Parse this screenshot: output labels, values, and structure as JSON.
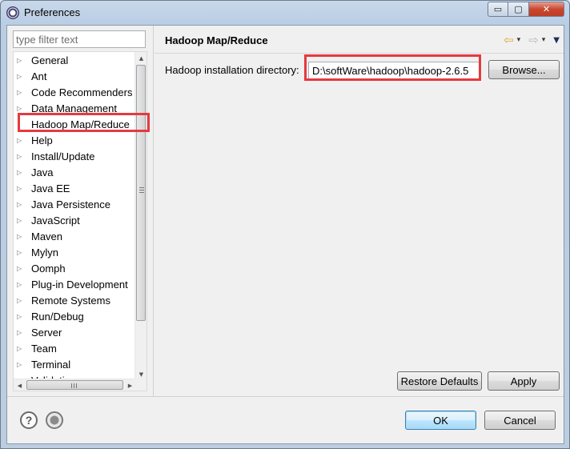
{
  "window": {
    "title": "Preferences",
    "minimize_glyph": "▭",
    "maximize_glyph": "▢",
    "close_glyph": "✕"
  },
  "left_pane": {
    "filter_placeholder": "type filter text",
    "tree_items": [
      {
        "label": "General",
        "has_arrow": true
      },
      {
        "label": "Ant",
        "has_arrow": true
      },
      {
        "label": "Code Recommenders",
        "has_arrow": true
      },
      {
        "label": "Data Management",
        "has_arrow": true
      },
      {
        "label": "Hadoop Map/Reduce",
        "has_arrow": false,
        "selected": true
      },
      {
        "label": "Help",
        "has_arrow": true
      },
      {
        "label": "Install/Update",
        "has_arrow": true
      },
      {
        "label": "Java",
        "has_arrow": true
      },
      {
        "label": "Java EE",
        "has_arrow": true
      },
      {
        "label": "Java Persistence",
        "has_arrow": true
      },
      {
        "label": "JavaScript",
        "has_arrow": true
      },
      {
        "label": "Maven",
        "has_arrow": true
      },
      {
        "label": "Mylyn",
        "has_arrow": true
      },
      {
        "label": "Oomph",
        "has_arrow": true
      },
      {
        "label": "Plug-in Development",
        "has_arrow": true
      },
      {
        "label": "Remote Systems",
        "has_arrow": true
      },
      {
        "label": "Run/Debug",
        "has_arrow": true
      },
      {
        "label": "Server",
        "has_arrow": true
      },
      {
        "label": "Team",
        "has_arrow": true
      },
      {
        "label": "Terminal",
        "has_arrow": true
      },
      {
        "label": "Validation",
        "has_arrow": false
      }
    ],
    "arrow_glyph": "▷",
    "scroll_up_glyph": "▲",
    "scroll_down_glyph": "▼",
    "scroll_left_glyph": "◀",
    "scroll_right_glyph": "▶"
  },
  "right_pane": {
    "title": "Hadoop Map/Reduce",
    "nav_back_glyph": "⇦",
    "nav_fwd_glyph": "⇨",
    "dropdown_glyph": "▾",
    "view_menu_glyph": "▼",
    "dir_label": "Hadoop installation directory:",
    "dir_value": "D:\\softWare\\hadoop\\hadoop-2.6.5",
    "browse_label": "Browse...",
    "restore_label": "Restore Defaults",
    "apply_label": "Apply"
  },
  "footer": {
    "help_glyph": "?",
    "ok_label": "OK",
    "cancel_label": "Cancel"
  },
  "colors": {
    "highlight": "#e53a3f",
    "accent": "#3c7fb1"
  }
}
